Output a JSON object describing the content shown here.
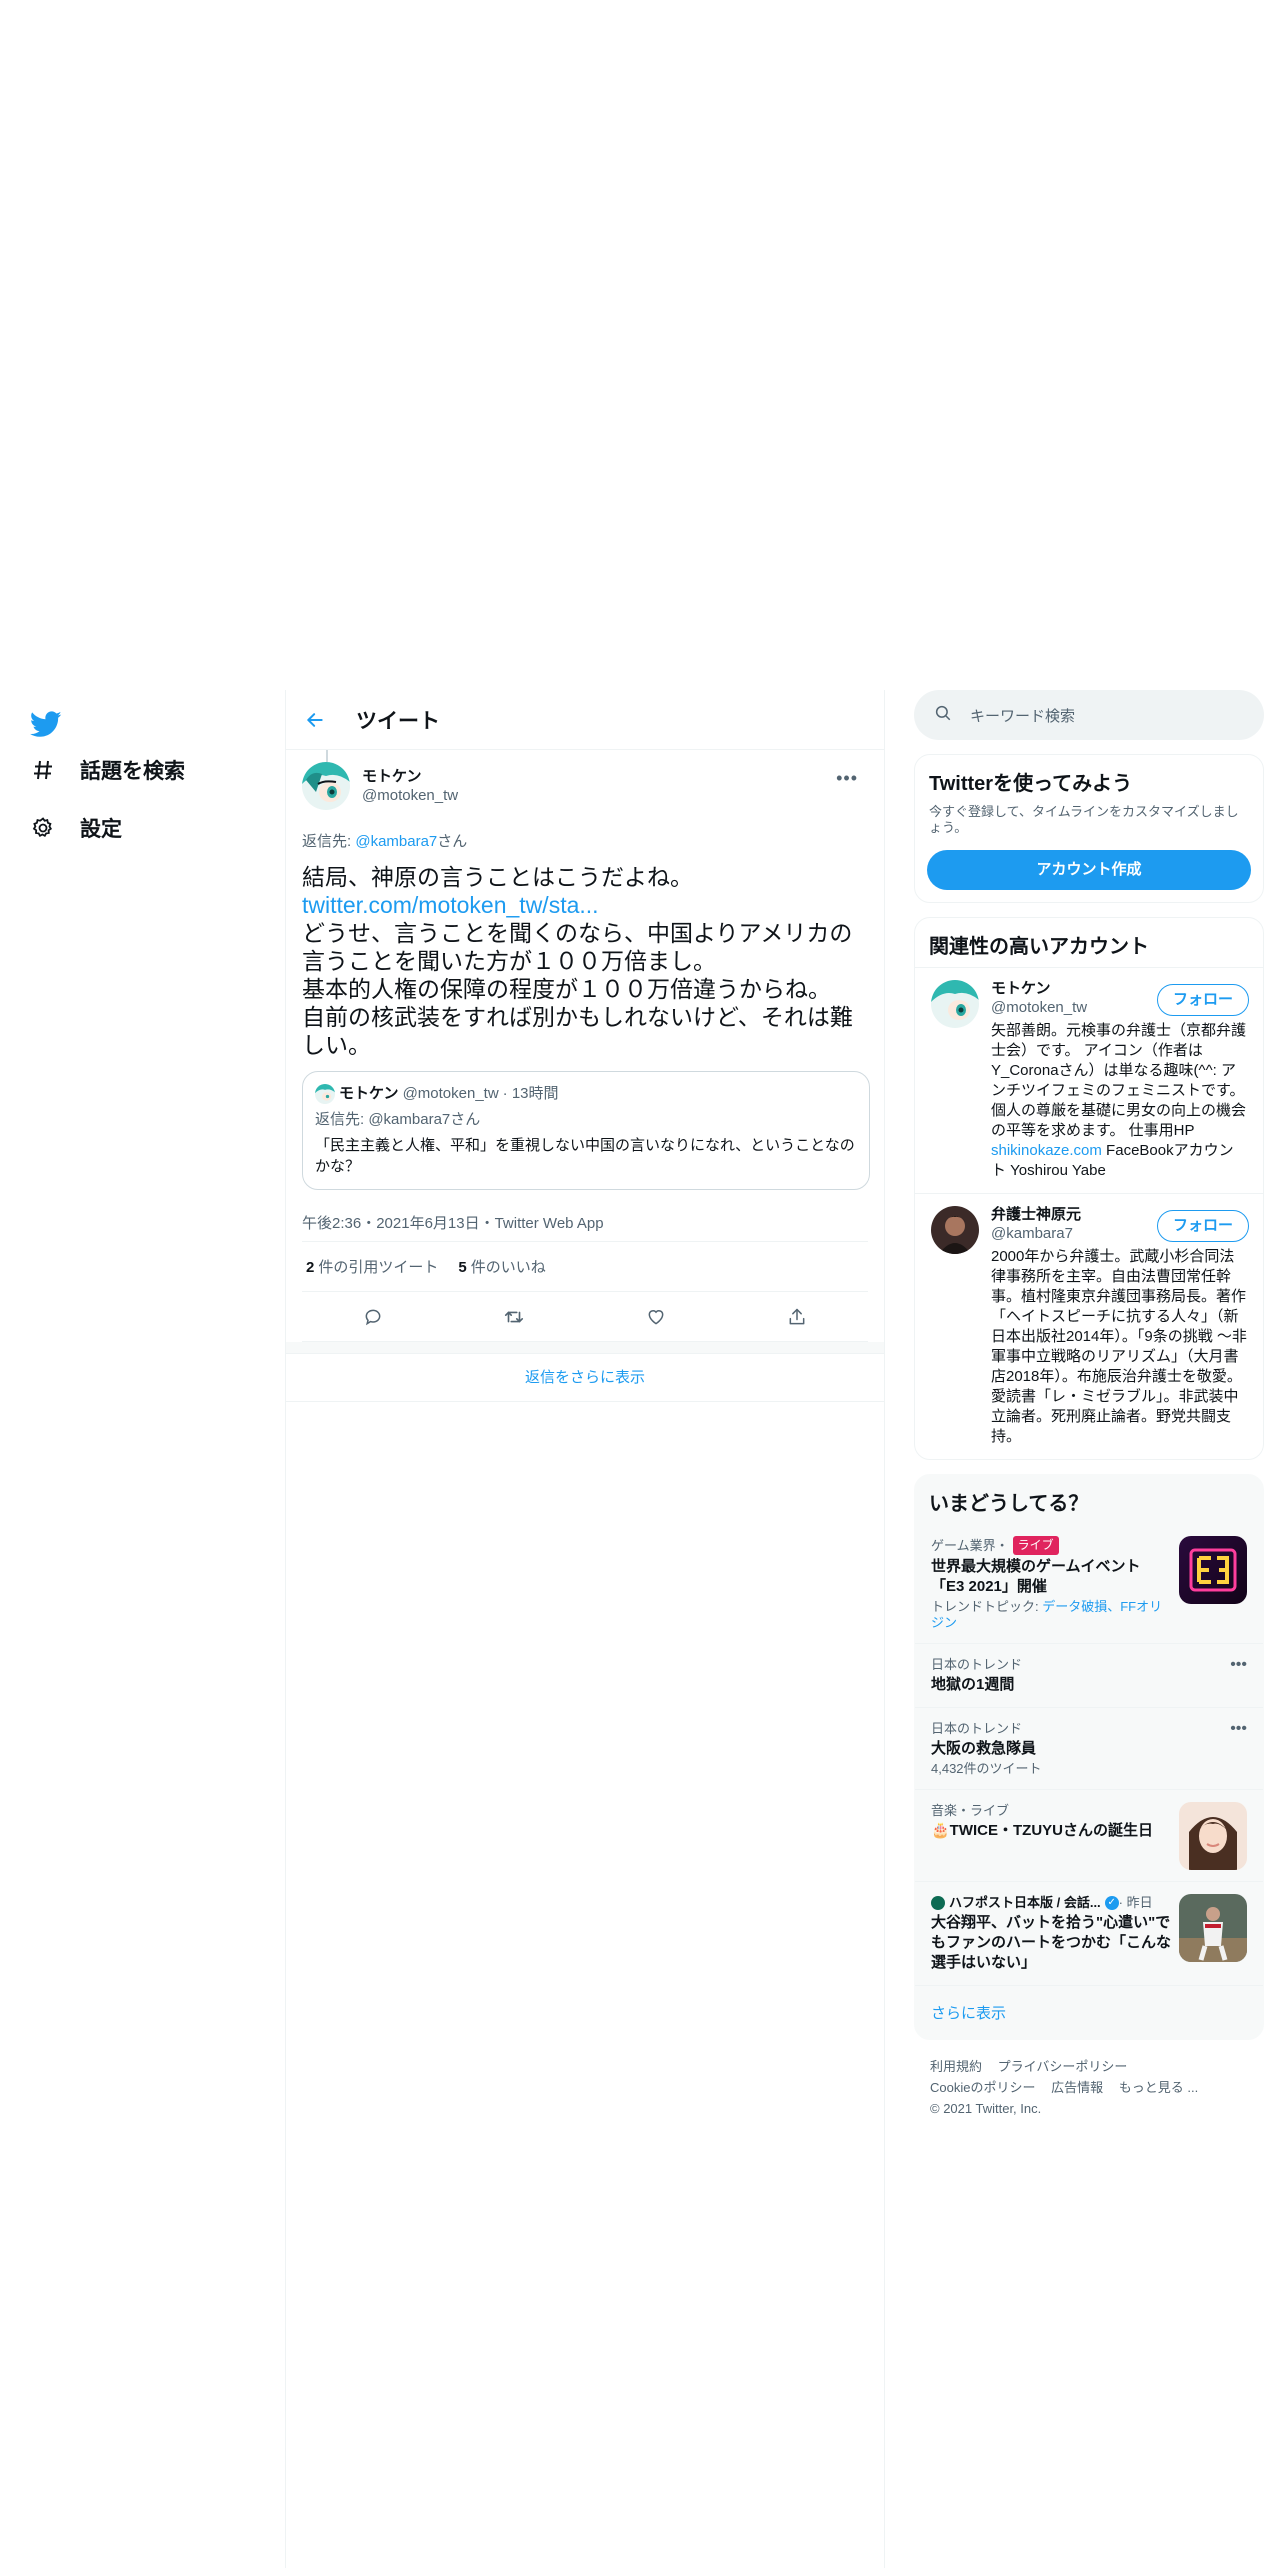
{
  "nav": {
    "items": [
      {
        "label": "話題を検索",
        "icon": "hashtag-icon"
      },
      {
        "label": "設定",
        "icon": "gear-icon"
      }
    ]
  },
  "main": {
    "title": "ツイート",
    "tweet": {
      "name": "モトケン",
      "handle": "@motoken_tw",
      "reply_prefix": "返信先: ",
      "reply_to": "@kambara7",
      "reply_suffix": "さん",
      "text_line1": "結局、神原の言うことはこうだよね。",
      "text_link": "twitter.com/motoken_tw/sta...",
      "text_rest": "どうせ、言うことを聞くのなら、中国よりアメリカの言うことを聞いた方が１００万倍まし。\n基本的人権の保障の程度が１００万倍違うからね。\n自前の核武装をすれば別かもしれないけど、それは難しい。",
      "quote": {
        "name": "モトケン",
        "handle": "@motoken_tw",
        "time": "· 13時間",
        "reply": "返信先: @kambara7さん",
        "text": "「民主主義と人権、平和」を重視しない中国の言いなりになれ、ということなのかな？"
      },
      "meta": "午後2:36・2021年6月13日・Twitter Web App",
      "quote_count": "2",
      "quote_label": "件の引用ツイート",
      "like_count": "5",
      "like_label": "件のいいね"
    },
    "show_more_replies": "返信をさらに表示"
  },
  "side": {
    "search_placeholder": "キーワード検索",
    "signup": {
      "title": "Twitterを使ってみよう",
      "desc": "今すぐ登録して、タイムラインをカスタマイズしましょう。",
      "button": "アカウント作成"
    },
    "relevant": {
      "title": "関連性の高いアカウント",
      "follow_label": "フォロー",
      "accounts": [
        {
          "name": "モトケン",
          "handle": "@motoken_tw",
          "bio": "矢部善朗。元検事の弁護士（京都弁護士会）です。 アイコン（作者はY_Coronaさん）は単なる趣味(^^: アンチツイフェミのフェミニストです。個人の尊厳を基礎に男女の向上の機会の平等を求めます。 仕事用HP ",
          "bio_link": "shikinokaze.com",
          "bio_tail": " FaceBookアカウント Yoshirou Yabe"
        },
        {
          "name": "弁護士神原元",
          "handle": "@kambara7",
          "bio": "2000年から弁護士。武蔵小杉合同法律事務所を主宰。自由法曹団常任幹事。植村隆東京弁護団事務局長。著作「ヘイトスピーチに抗する人々」（新日本出版社2014年）。「9条の挑戦 ～非軍事中立戦略のリアリズム」（大月書店2018年）。布施辰治弁護士を敬愛。愛読書「レ・ミゼラブル」。非武装中立論者。死刑廃止論者。野党共闘支持。"
        }
      ]
    },
    "trends": {
      "title": "いまどうしてる？",
      "items": [
        {
          "category": "ゲーム業界・",
          "badge": "ライブ",
          "title": "世界最大規模のゲームイベント「E3 2021」開催",
          "sub_prefix": "トレンドトピック: ",
          "sub_link": "データ破損、FFオリジン",
          "thumb": "e3-thumbnail"
        },
        {
          "category": "日本のトレンド",
          "title": "地獄の1週間"
        },
        {
          "category": "日本のトレンド",
          "title": "大阪の救急隊員",
          "sub": "4,432件のツイート"
        },
        {
          "category": "音楽・ライブ",
          "title": "🎂TWICE・TZUYUさんの誕生日",
          "thumb": "portrait-thumbnail"
        },
        {
          "category": "ハフポスト日本版 / 会話...",
          "category_suffix": " · 昨日",
          "title": "大谷翔平、バットを拾う\"心遣い\"でもファンのハートをつかむ「こんな選手はいない」",
          "thumb": "baseball-thumbnail"
        }
      ],
      "see_more": "さらに表示"
    },
    "footer": {
      "links": [
        "利用規約",
        "プライバシーポリシー",
        "Cookieのポリシー",
        "広告情報",
        "もっと見る ..."
      ],
      "copyright": "© 2021 Twitter, Inc."
    }
  },
  "colors": {
    "accent": "#1d9bf0",
    "text": "#0f1419",
    "muted": "#536471",
    "live": "#e0245e"
  }
}
